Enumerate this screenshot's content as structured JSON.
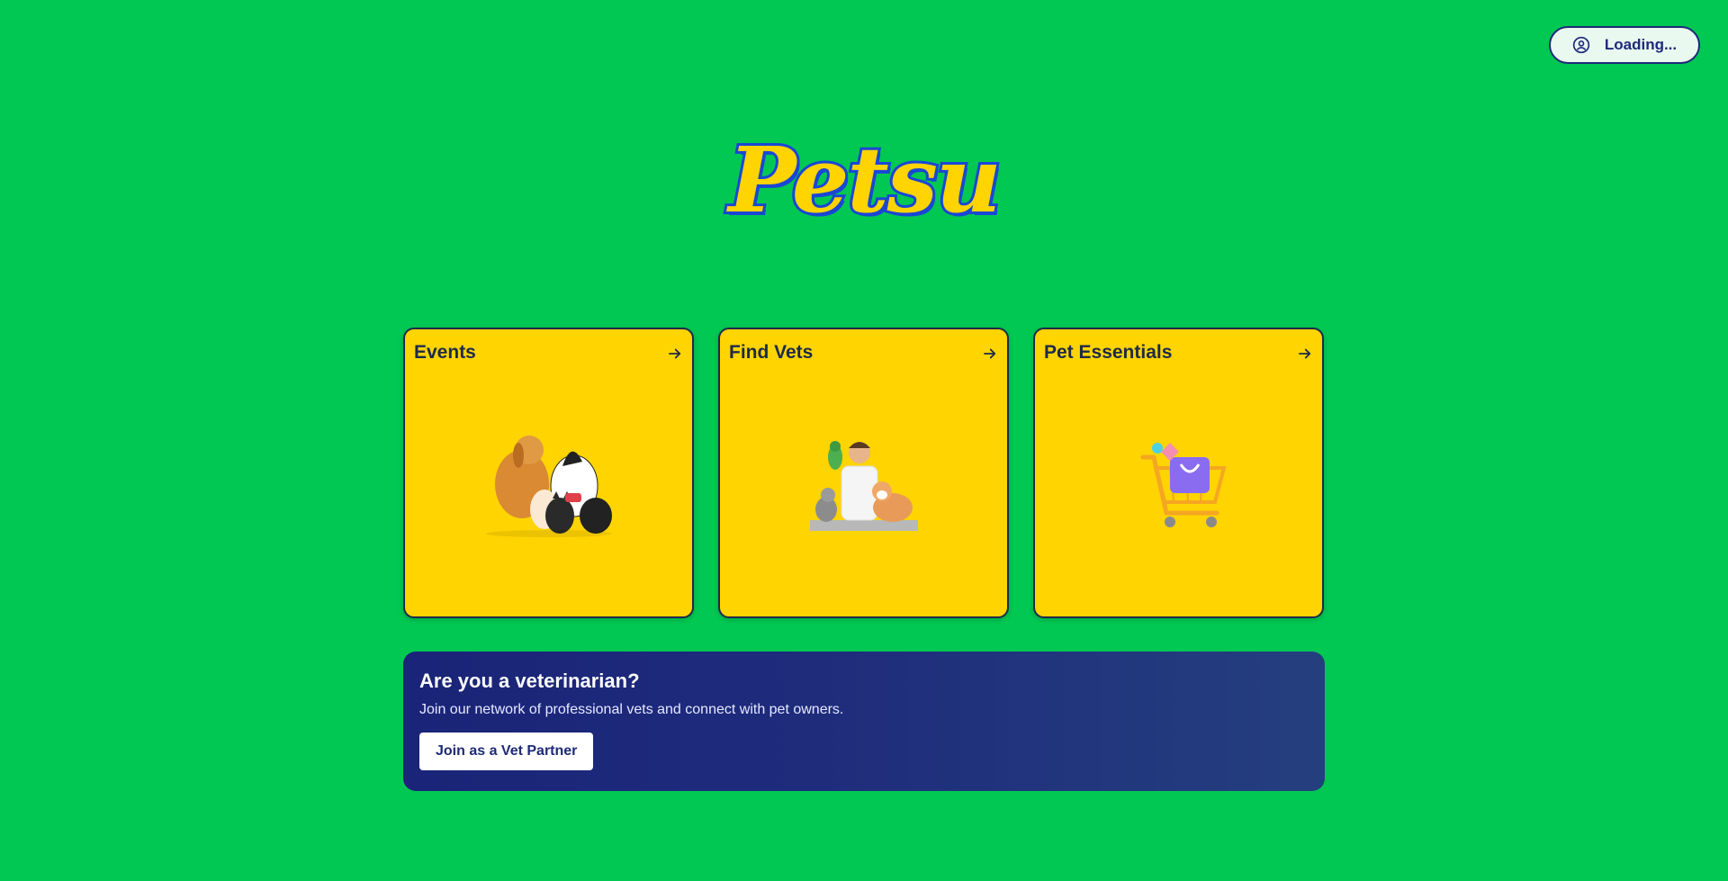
{
  "header": {
    "account_label": "Loading...",
    "account_icon": "user-circle-icon"
  },
  "logo": {
    "text": "Petsu"
  },
  "cards": [
    {
      "title": "Events",
      "icon": "arrow-right-icon",
      "illustration": "pets-group-illustration"
    },
    {
      "title": "Find Vets",
      "icon": "arrow-right-icon",
      "illustration": "veterinarian-with-pets-illustration"
    },
    {
      "title": "Pet Essentials",
      "icon": "arrow-right-icon",
      "illustration": "shopping-cart-illustration"
    }
  ],
  "vet_banner": {
    "title": "Are you a veterinarian?",
    "subtitle": "Join our network of professional vets and connect with pet owners.",
    "button_label": "Join as a Vet Partner"
  },
  "colors": {
    "background": "#00c853",
    "card": "#ffd400",
    "accent": "#1e2a78",
    "logo_outline": "#1a46d6"
  }
}
